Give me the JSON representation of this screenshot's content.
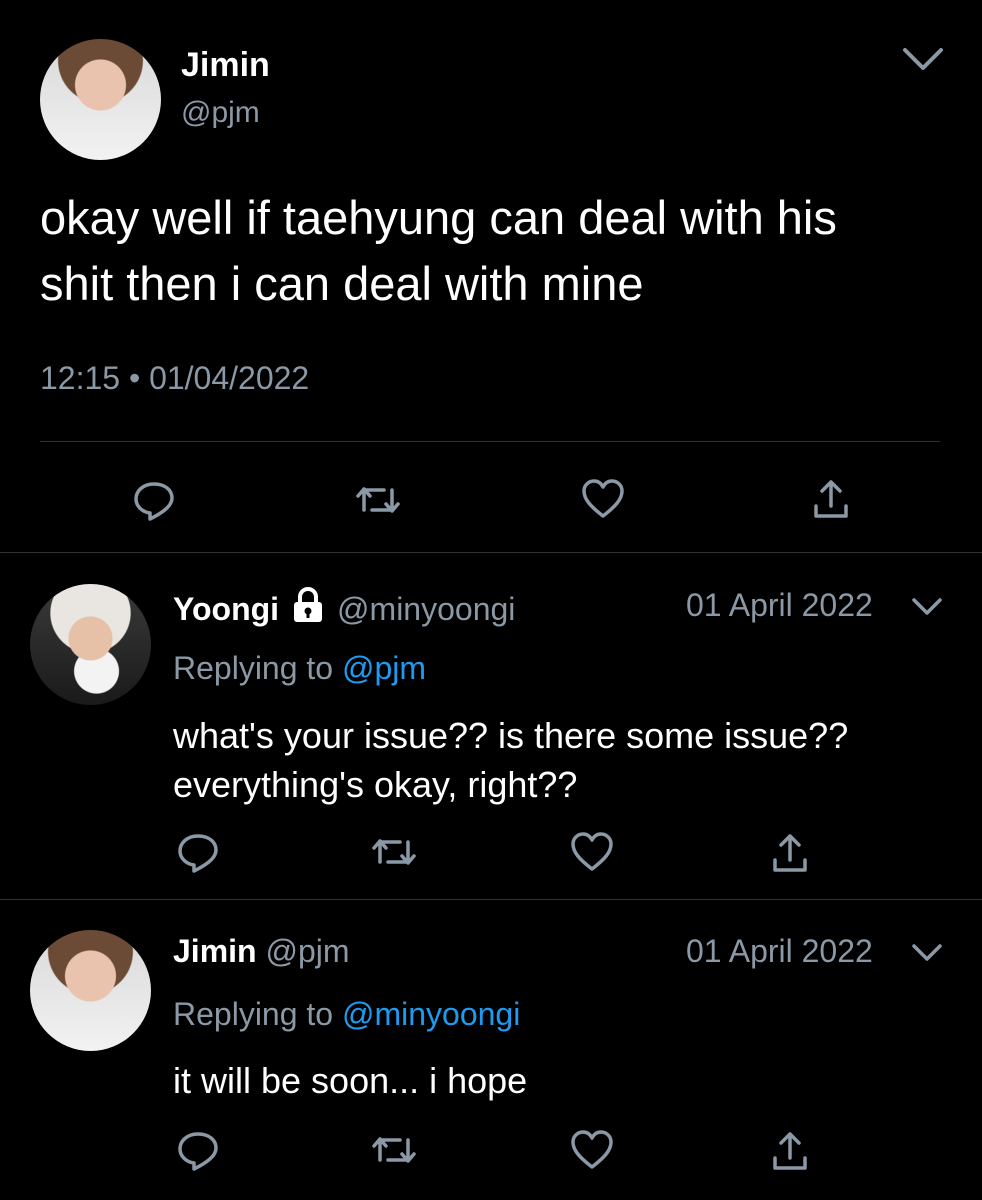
{
  "main_tweet": {
    "name": "Jimin",
    "handle": "@pjm",
    "text_line1": "okay well if taehyung can deal with his",
    "text_line2": "shit then i can deal with mine",
    "time": "12:15",
    "dot": "•",
    "date": "01/04/2022"
  },
  "reply1": {
    "name": "Yoongi",
    "handle": "@minyoongi",
    "date": "01 April 2022",
    "replying_label": "Replying to",
    "replying_to": "@pjm",
    "text_line1": "what's your issue?? is there some issue??",
    "text_line2": "everything's okay, right??"
  },
  "reply2": {
    "name": "Jimin",
    "handle": "@pjm",
    "date": "01 April 2022",
    "replying_label": "Replying to",
    "replying_to": "@minyoongi",
    "text_line1": "it will be soon... i hope"
  },
  "icons": [
    "reply-icon",
    "retweet-icon",
    "like-icon",
    "share-icon",
    "chevron-down-icon",
    "lock-icon"
  ],
  "colors": {
    "background": "#000000",
    "text": "#ffffff",
    "muted": "#8b98a5",
    "link": "#1d9bf0",
    "divider": "#2f3336"
  }
}
